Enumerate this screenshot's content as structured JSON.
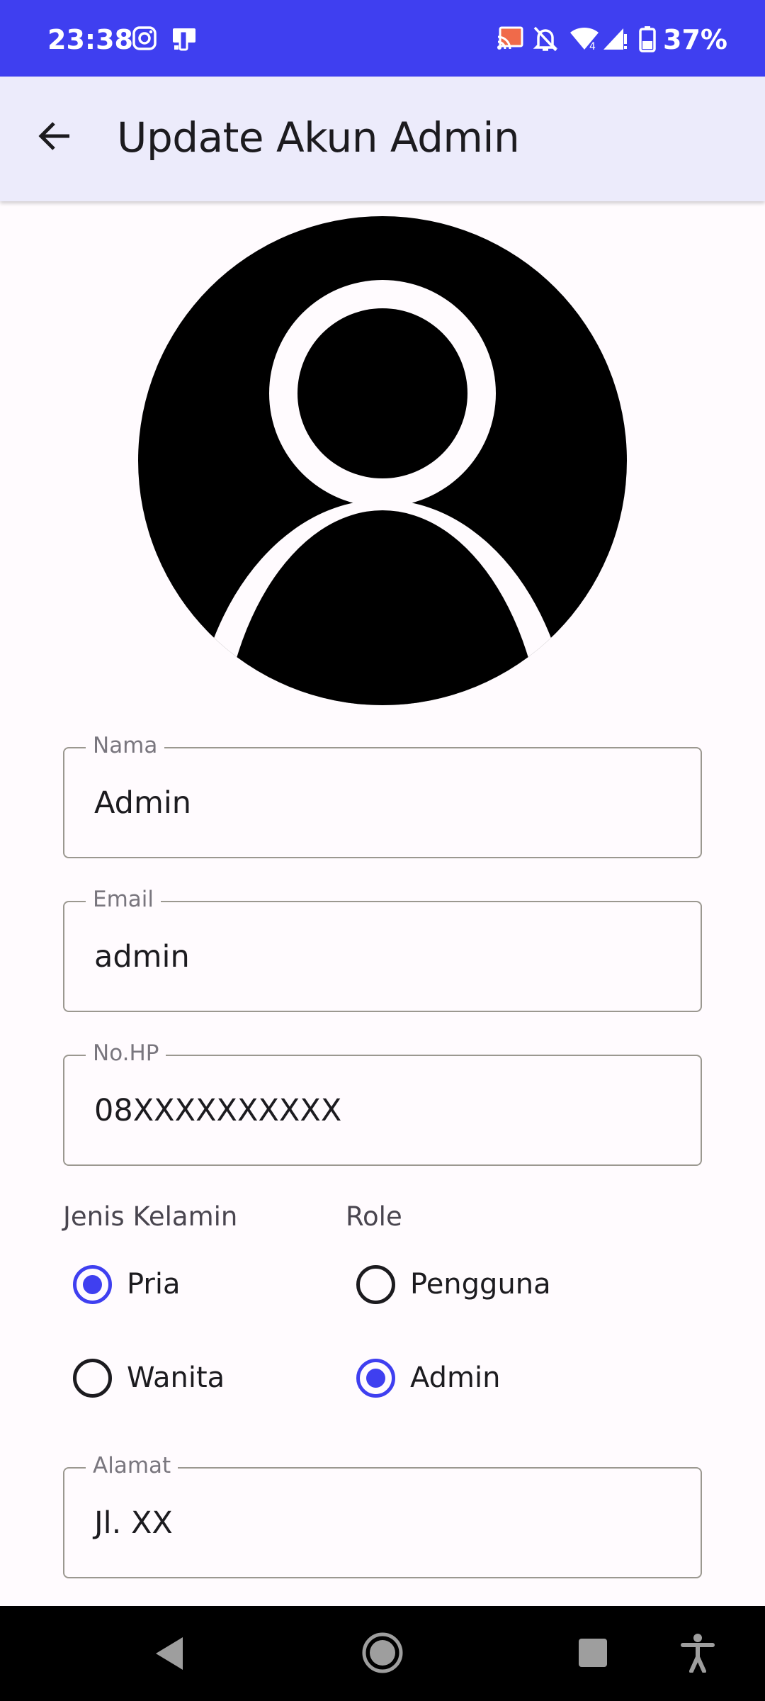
{
  "status_bar": {
    "time": "23:38",
    "battery_percent": "37%",
    "icons": [
      "instagram-icon",
      "device-icon",
      "cast-icon",
      "bell-off-icon",
      "wifi-icon",
      "signal-icon",
      "battery-icon"
    ]
  },
  "app_bar": {
    "back_icon": "arrow-left-icon",
    "title": "Update Akun Admin"
  },
  "avatar": {
    "icon": "person-circle-icon"
  },
  "form": {
    "nama": {
      "label": "Nama",
      "value": "Admin"
    },
    "email": {
      "label": "Email",
      "value": "admin"
    },
    "nohp": {
      "label": "No.HP",
      "value": "08XXXXXXXXXX"
    },
    "jenis_kelamin": {
      "title": "Jenis Kelamin",
      "options": [
        {
          "label": "Pria",
          "checked": true
        },
        {
          "label": "Wanita",
          "checked": false
        }
      ]
    },
    "role": {
      "title": "Role",
      "options": [
        {
          "label": "Pengguna",
          "checked": false
        },
        {
          "label": "Admin",
          "checked": true
        }
      ]
    },
    "alamat": {
      "label": "Alamat",
      "value": "Jl. XX"
    }
  },
  "nav_bar": {
    "icons": [
      "nav-back-icon",
      "nav-home-icon",
      "nav-recents-icon",
      "accessibility-icon"
    ]
  },
  "colors": {
    "accent": "#3f3ff0",
    "app_bar_bg": "#ecebfb",
    "background": "#fffbfe"
  }
}
